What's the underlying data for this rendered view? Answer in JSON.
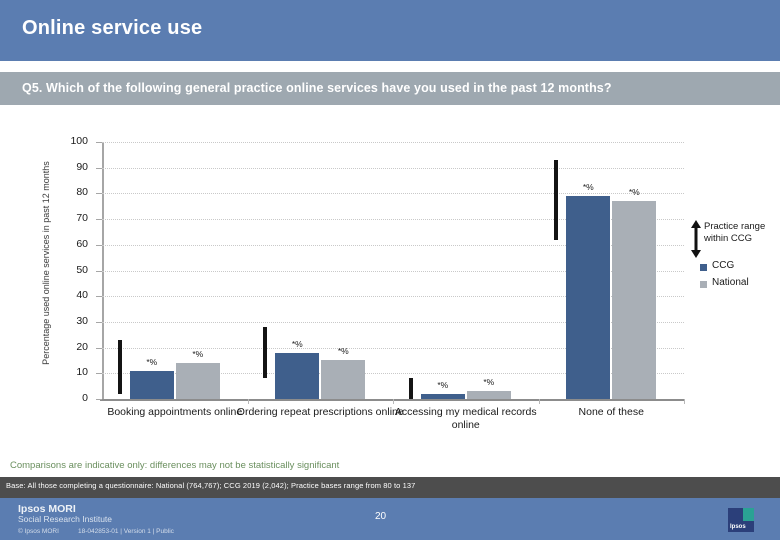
{
  "header": {
    "title": "Online service use",
    "question": "Q5. Which of the following general practice online services have you used in the past 12 months?"
  },
  "legend": {
    "range_label": "Practice range within CCG",
    "range_icon": "double-arrow-icon",
    "items": [
      {
        "label": "CCG",
        "color": "#3f5f8c"
      },
      {
        "label": "National",
        "color": "#a9afb6"
      }
    ]
  },
  "footer": {
    "note": "Comparisons are indicative only: differences may not be statistically significant",
    "base": "Base: All those completing a questionnaire: National (764,767); CCG 2019 (2,042); Practice bases range from 80 to 137",
    "brand_name": "Ipsos MORI",
    "brand_sub": "Social Research Institute",
    "copyright": "© Ipsos MORI",
    "reference": "18-042853-01 | Version 1 | Public",
    "slide_number": "20",
    "logo_word": "Ipsos"
  },
  "chart_data": {
    "type": "bar",
    "title": "Q5. Which of the following general practice online services have you used in the past 12 months?",
    "xlabel": "",
    "ylabel": "Percentage used online services in past 12 months",
    "ylim": [
      0,
      100
    ],
    "yticks": [
      0,
      10,
      20,
      30,
      40,
      50,
      60,
      70,
      80,
      90,
      100
    ],
    "grid": true,
    "legend_position": "right",
    "categories": [
      "Booking appointments online",
      "Ordering repeat prescriptions online",
      "Accessing my medical records online",
      "None of these"
    ],
    "series": [
      {
        "name": "CCG",
        "color": "#3f5f8c",
        "values": [
          11,
          18,
          2,
          79
        ]
      },
      {
        "name": "National",
        "color": "#a9afb6",
        "values": [
          14,
          15,
          3,
          77
        ]
      }
    ],
    "data_labels": {
      "CCG": [
        "*%",
        "*%",
        "*%",
        "*%"
      ],
      "National": [
        "*%",
        "*%",
        "*%",
        "*%"
      ]
    },
    "practice_range": [
      {
        "category": "Booking appointments online",
        "min": 2,
        "max": 23
      },
      {
        "category": "Ordering repeat prescriptions online",
        "min": 8,
        "max": 28
      },
      {
        "category": "Accessing my medical records online",
        "min": 0,
        "max": 8
      },
      {
        "category": "None of these",
        "min": 62,
        "max": 93
      }
    ]
  }
}
